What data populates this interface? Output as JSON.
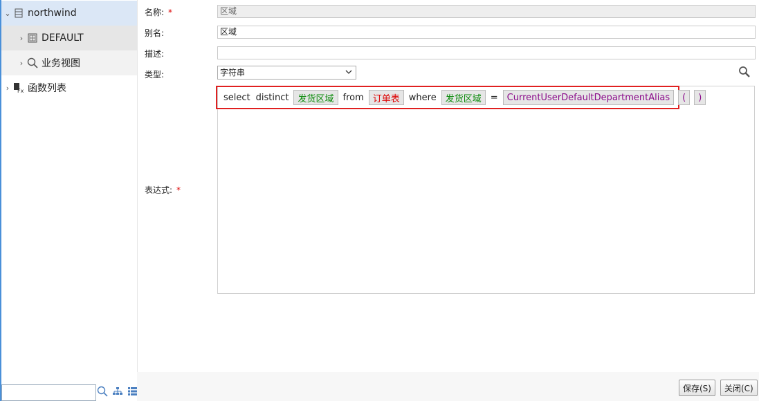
{
  "tree": {
    "root": "northwind",
    "default": "DEFAULT",
    "view": "业务视图",
    "func": "函数列表"
  },
  "form": {
    "name_label": "名称:",
    "alias_label": "别名:",
    "desc_label": "描述:",
    "type_label": "类型:",
    "expr_label": "表达式:",
    "required_mark": "*",
    "name_value": "区域",
    "alias_value": "区域",
    "desc_value": "",
    "type_value": "字符串"
  },
  "expression": {
    "t1": "select",
    "t2": "distinct",
    "t3": "发货区域",
    "t4": "from",
    "t5": "订单表",
    "t6": "where",
    "t7": "发货区域",
    "t8": "=",
    "t9": "CurrentUserDefaultDepartmentAlias",
    "t10": "(",
    "t11": ")"
  },
  "buttons": {
    "save": "保存(S)",
    "close": "关闭(C)"
  },
  "colors": {
    "accent": "#4a90d9",
    "field_green": "#0a8a0a",
    "table_red": "#dd0000",
    "func_purple": "#8a0a8a",
    "highlight": "#e02020"
  }
}
